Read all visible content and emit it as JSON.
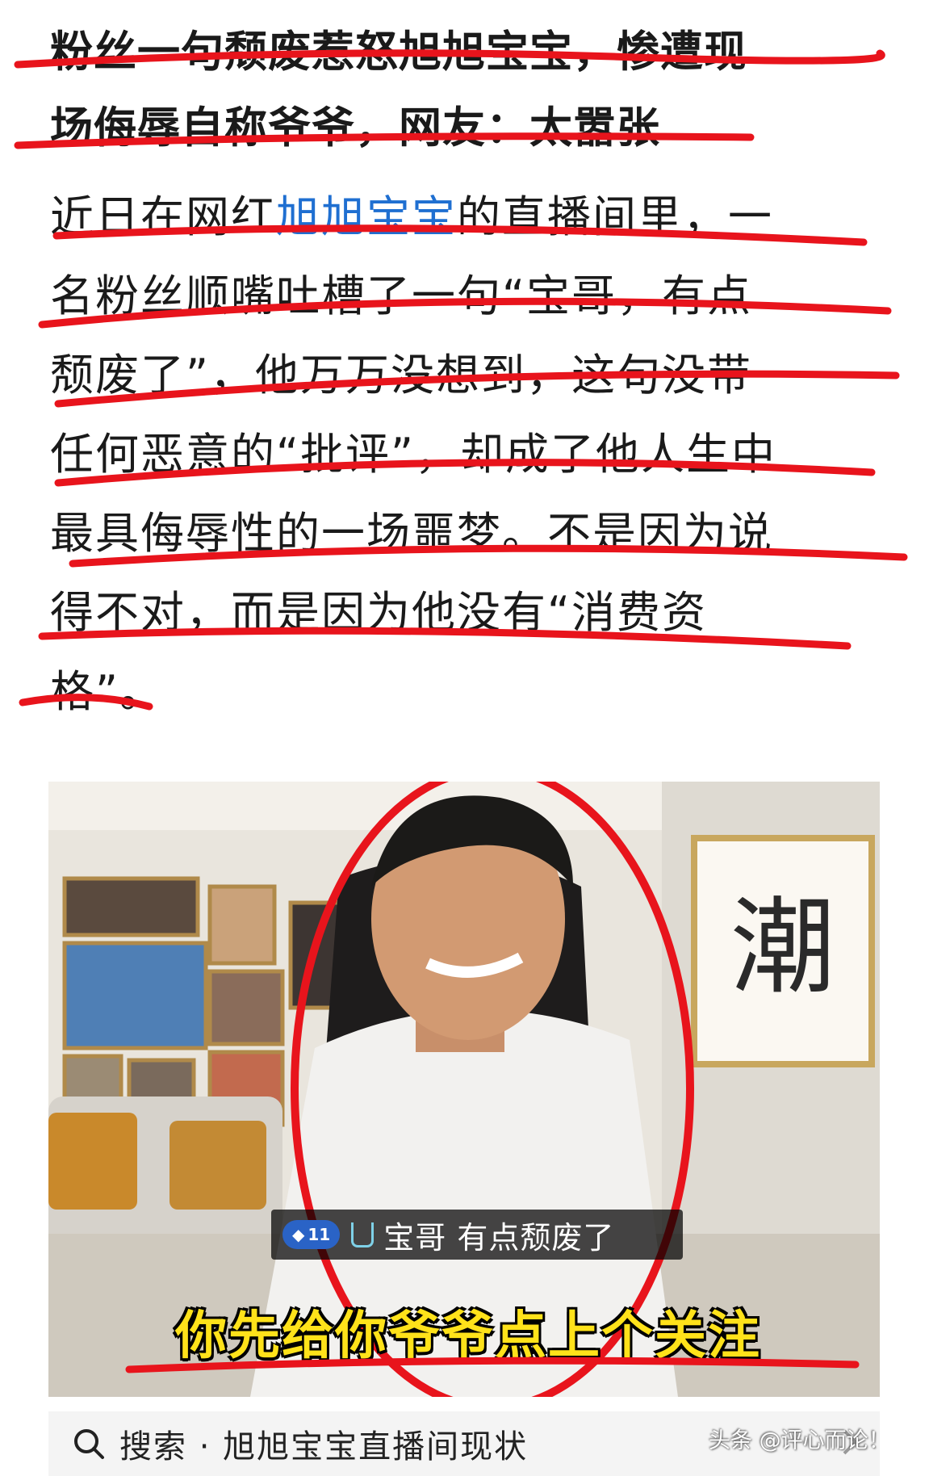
{
  "article": {
    "headline_lines": [
      "粉丝一句颓废惹怒旭旭宝宝，惨遭现",
      "场侮辱自称爷爷，网友：太嚣张"
    ],
    "body": {
      "prefix": "近日在网红",
      "link_text": "旭旭宝宝",
      "lines": [
        "的直播间里，一",
        "名粉丝顺嘴吐槽了一句“宝哥，有点",
        "颓废了”，他万万没想到，这句没带",
        "任何恶意的“批评”，却成了他人生中",
        "最具侮辱性的一场噩梦。不是因为说",
        "得不对，而是因为他没有“消费资",
        "格”。"
      ]
    }
  },
  "video_frame": {
    "calligraphy": "潮",
    "fan_badge_level": "11",
    "live_comment": "宝哥 有点颓废了",
    "subtitle": "你先给你爷爷点上个关注"
  },
  "search": {
    "text": "搜索 · 旭旭宝宝直播间现状"
  },
  "watermark": "头条 @评心而论！",
  "colors": {
    "annotation_red": "#e8141c",
    "link_blue": "#1f6fd1",
    "subtitle_yellow": "#ffe21a"
  }
}
